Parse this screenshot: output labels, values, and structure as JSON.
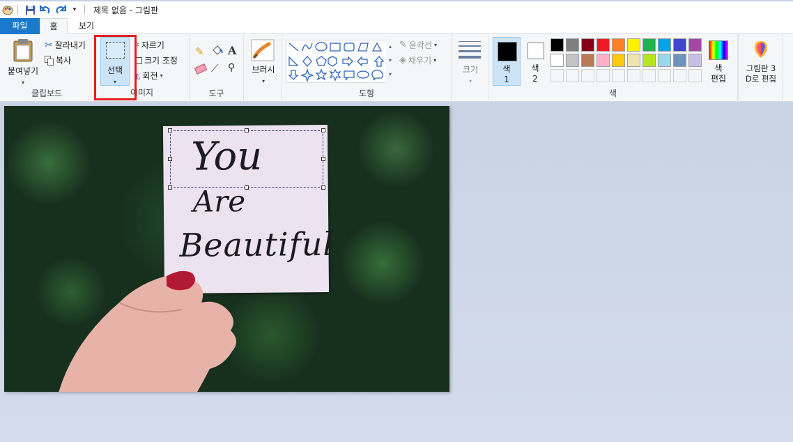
{
  "window": {
    "title": "제목 없음 - 그림판"
  },
  "tabs": {
    "file": "파일",
    "home": "홈",
    "view": "보기"
  },
  "clipboard": {
    "paste": "붙여넣기",
    "cut": "잘라내기",
    "copy": "복사",
    "label": "클립보드"
  },
  "image": {
    "select": "선택",
    "crop": "자르기",
    "resize": "크기 조정",
    "rotate": "회전",
    "label": "이미지"
  },
  "tools": {
    "label": "도구"
  },
  "brushes": {
    "label": "브러시"
  },
  "shapes": {
    "outline": "윤곽선",
    "fill": "채우기",
    "label": "도형"
  },
  "size": {
    "label": "크기"
  },
  "colors": {
    "color1": "색\n1",
    "color2": "색\n2",
    "edit": "색\n편집",
    "label": "색",
    "color1_value": "#000000",
    "color2_value": "#ffffff",
    "palette_row1": [
      "#000000",
      "#7f7f7f",
      "#880015",
      "#ed1c24",
      "#ff7f27",
      "#fff200",
      "#22b14c",
      "#00a2e8",
      "#3f48cc",
      "#a349a4"
    ],
    "palette_row2": [
      "#ffffff",
      "#c3c3c3",
      "#b97a57",
      "#ffaec9",
      "#ffc90e",
      "#efe4b0",
      "#b5e61d",
      "#99d9ea",
      "#7092be",
      "#c8bfe7"
    ]
  },
  "paint3d": {
    "label": "그림판 3\nD로 편집"
  },
  "canvas": {
    "line1": "You",
    "line2": "Are",
    "line3": "Beautiful"
  }
}
